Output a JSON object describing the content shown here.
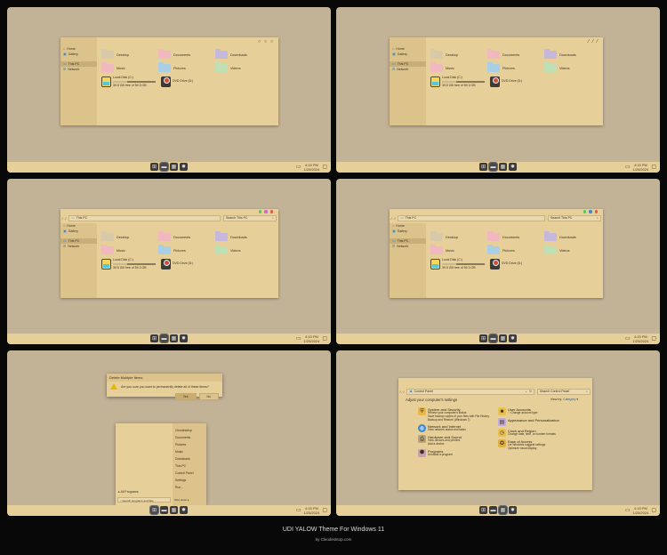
{
  "caption": {
    "title": "UDI YALOW Theme For Windows 11",
    "credit": "by Cleodesktop.com"
  },
  "colors": {
    "folder_yellow": "#d8c9a8",
    "folder_pink": "#f2b8c0",
    "folder_purple": "#c5b8dc",
    "folder_blue": "#a9cfe6",
    "folder_green": "#bfe0b4"
  },
  "taskbar": {
    "time": "4:15 PM",
    "date": "1/25/2024"
  },
  "sidebar": {
    "home": "Home",
    "gallery": "Gallery",
    "thispc": "This PC",
    "network": "Network"
  },
  "folders": [
    {
      "label": "Desktop",
      "color": "#d8c9a8"
    },
    {
      "label": "Documents",
      "color": "#f2b8c0"
    },
    {
      "label": "Downloads",
      "color": "#c5b8dc"
    },
    {
      "label": "Music",
      "color": "#f2b8c0"
    },
    {
      "label": "Pictures",
      "color": "#a9cfe6"
    },
    {
      "label": "Videos",
      "color": "#bfe0b4"
    }
  ],
  "drives": {
    "local": {
      "label": "Local Disk (C:)",
      "free": "39.5 GB free of 59.3 GB",
      "used_fraction": 0.33
    },
    "dvd": {
      "label": "DVD Drive (D:)"
    }
  },
  "explorer": {
    "address": "This PC",
    "search": "Search This PC"
  },
  "dialog": {
    "title": "Delete Multiple Items",
    "message": "Are you sure you want to permanently delete all of these items?",
    "yes": "Yes",
    "no": "No"
  },
  "startmenu": {
    "items": [
      "Cleodesktop",
      "Documents",
      "Pictures",
      "Music",
      "Downloads",
      "This PC",
      "Control Panel",
      "Settings",
      "Run..."
    ],
    "all_programs": "All Programs",
    "search": "Search programs and files",
    "shutdown": "Shut down"
  },
  "controlpanel": {
    "address": "Control Panel",
    "search": "Search Control Panel",
    "heading": "Adjust your computer's settings",
    "view_by_label": "View by:",
    "view_by_value": "Category",
    "left": [
      {
        "title": "System and Security",
        "links": [
          "Review your computer's status",
          "Save backup copies of your files with File History",
          "Backup and Restore (Windows 7)"
        ]
      },
      {
        "title": "Network and Internet",
        "links": [
          "View network status and tasks"
        ]
      },
      {
        "title": "Hardware and Sound",
        "links": [
          "View devices and printers",
          "Add a device"
        ]
      },
      {
        "title": "Programs",
        "links": [
          "Uninstall a program"
        ]
      }
    ],
    "right": [
      {
        "title": "User Accounts",
        "links": [
          "Change account type"
        ]
      },
      {
        "title": "Appearance and Personalization",
        "links": []
      },
      {
        "title": "Clock and Region",
        "links": [
          "Change date, time, or number formats"
        ]
      },
      {
        "title": "Ease of Access",
        "links": [
          "Let Windows suggest settings",
          "Optimize visual display"
        ]
      }
    ]
  }
}
